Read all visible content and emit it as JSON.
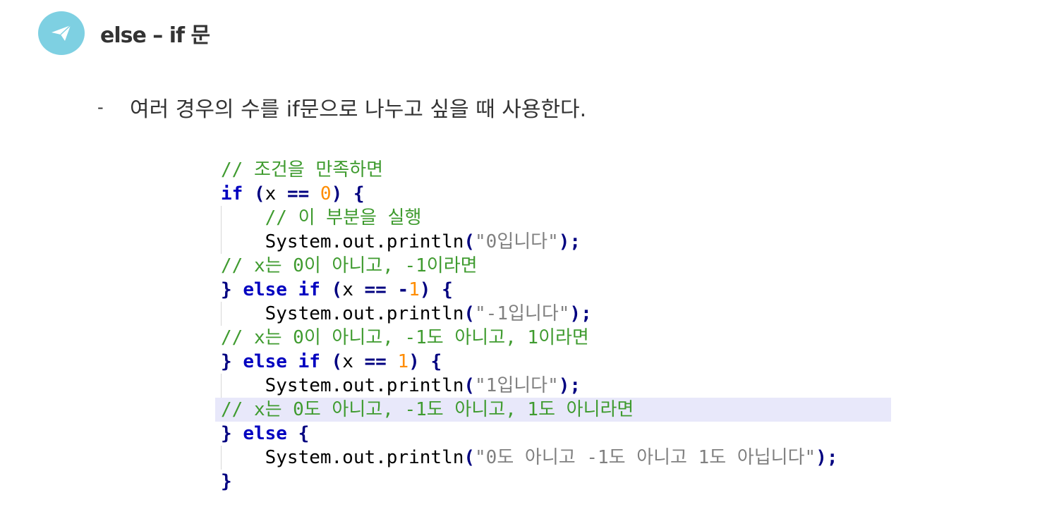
{
  "header": {
    "icon": "paper-plane-icon",
    "icon_color": "#7ed0e2",
    "title": "else – if 문"
  },
  "bullet": {
    "marker": "-",
    "text": "여러 경우의 수를 if문으로 나누고 싶을 때 사용한다."
  },
  "code": {
    "highlight_color": "#e8e8fa",
    "colors": {
      "comment": "#3f9b2f",
      "keyword": "#0000c0",
      "number": "#ff8c00",
      "string": "#808080"
    },
    "lines": [
      "// 조건을 만족하면",
      "if (x == 0) {",
      "    // 이 부분을 실행",
      "    System.out.println(\"0입니다\");",
      "// x는 0이 아니고, -1이라면",
      "} else if (x == -1) {",
      "    System.out.println(\"-1입니다\");",
      "// x는 0이 아니고, -1도 아니고, 1이라면",
      "} else if (x == 1) {",
      "    System.out.println(\"1입니다\");",
      "// x는 0도 아니고, -1도 아니고, 1도 아니라면",
      "} else {",
      "    System.out.println(\"0도 아니고 -1도 아니고 1도 아닙니다\");",
      "}"
    ]
  }
}
